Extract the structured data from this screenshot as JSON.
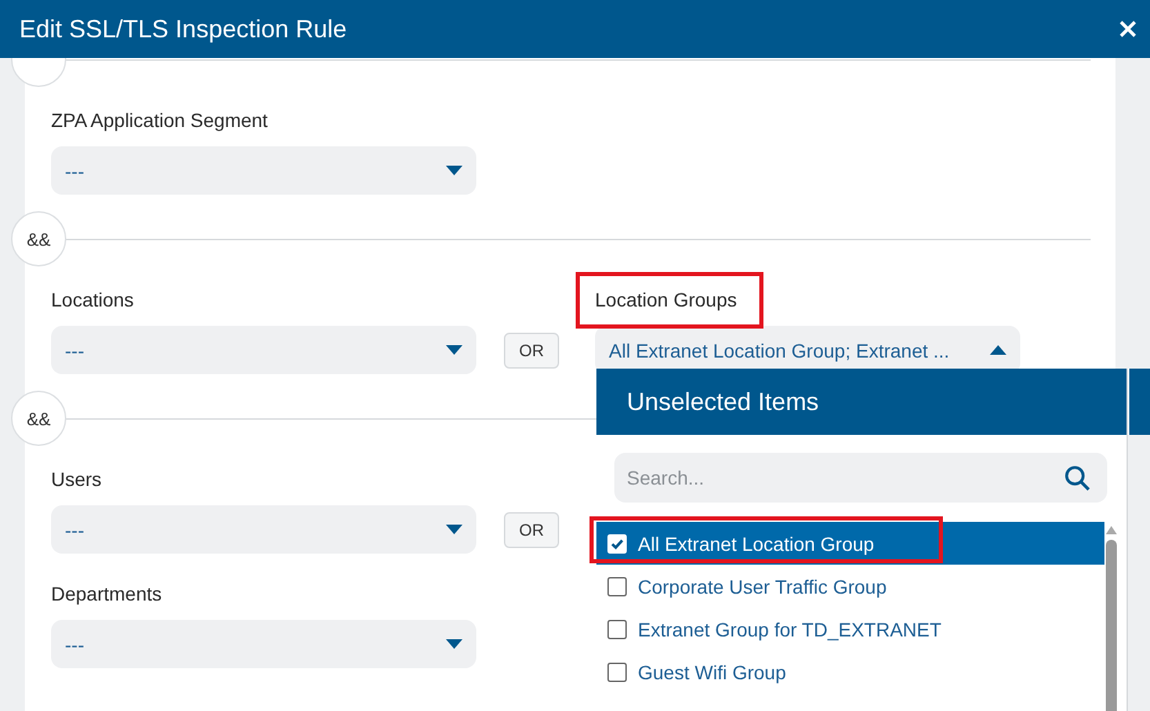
{
  "window": {
    "title": "Edit SSL/TLS Inspection Rule"
  },
  "sections": [
    {
      "rows": [
        {
          "fields": [
            {
              "label": "ZPA Application Segment",
              "value": "---",
              "expanded": false,
              "highlighted": false
            }
          ]
        }
      ]
    },
    {
      "connector": "&&",
      "rows": [
        {
          "fields": [
            {
              "label": "Locations",
              "value": "---",
              "expanded": false,
              "highlighted": false
            },
            {
              "label": "Location Groups",
              "value": "All Extranet Location Group; Extranet ...",
              "expanded": true,
              "highlighted": true
            }
          ],
          "joiner": "OR"
        }
      ]
    },
    {
      "connector": "&&",
      "rows": [
        {
          "fields": [
            {
              "label": "Users",
              "value": "---",
              "expanded": false,
              "highlighted": false
            }
          ],
          "joiner": "OR"
        },
        {
          "fields": [
            {
              "label": "Departments",
              "value": "---",
              "expanded": false,
              "highlighted": false
            }
          ]
        }
      ]
    }
  ],
  "dropdown": {
    "title": "Unselected Items",
    "search": {
      "placeholder": "Search..."
    },
    "items": [
      {
        "label": "All Extranet Location Group",
        "checked": true,
        "selected": true,
        "highlighted": true
      },
      {
        "label": "Corporate User Traffic Group",
        "checked": false,
        "selected": false,
        "highlighted": false
      },
      {
        "label": "Extranet Group for TD_EXTRANET",
        "checked": false,
        "selected": false,
        "highlighted": false
      },
      {
        "label": "Guest Wifi Group",
        "checked": false,
        "selected": false,
        "highlighted": false
      }
    ]
  }
}
